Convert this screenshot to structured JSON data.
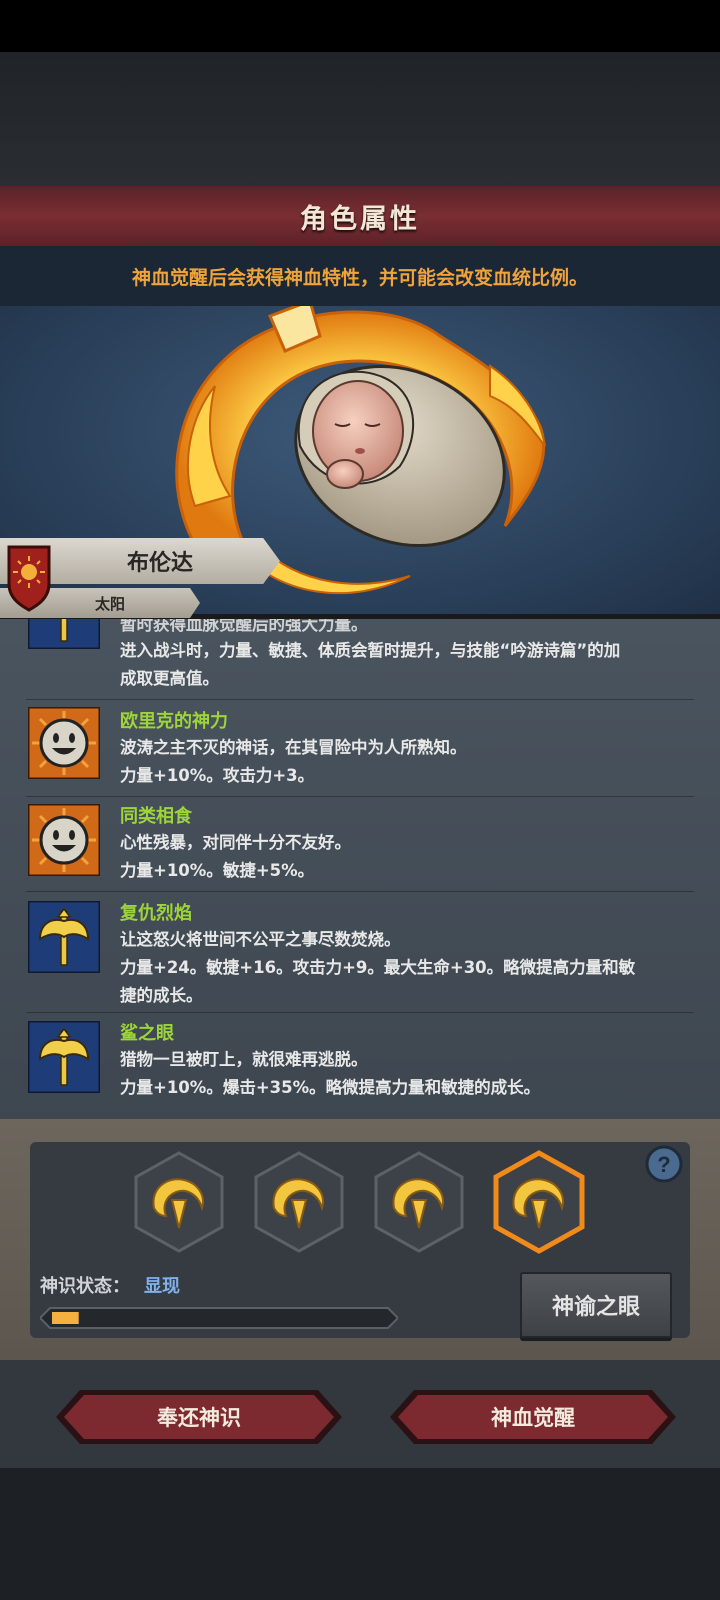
{
  "header": {
    "title": "角色属性",
    "notice": "神血觉醒后会获得神血特性，并可能会改变血统比例。"
  },
  "character": {
    "name": "布伦达",
    "deity": "太阳",
    "portrait": "swaddled-baby-with-golden-flame-ring"
  },
  "traits": {
    "partial": {
      "icon": "golden-axe-icon",
      "line_cut": "暂时获得血脉觉醒后的强大力量。",
      "line1": "进入战斗时，力量、敏捷、体质会暂时提升，与技能“吟游诗篇”的加",
      "line2": "成取更高值。"
    },
    "items": [
      {
        "icon": "smiling-face-icon",
        "name": "欧里克的神力",
        "line1": "波涛之主不灭的神话，在其冒险中为人所熟知。",
        "line2": "力量+10%。攻击力+3。"
      },
      {
        "icon": "smiling-face-icon",
        "name": "同类相食",
        "line1": "心性残暴，对同伴十分不友好。",
        "line2": "力量+10%。敏捷+5%。"
      },
      {
        "icon": "golden-axe-icon",
        "name": "复仇烈焰",
        "line1": "让这怒火将世间不公平之事尽数焚烧。",
        "line2": "力量+24。敏捷+16。攻击力+9。最大生命+30。略微提高力量和敏",
        "line3": "捷的成长。"
      },
      {
        "icon": "golden-axe-icon",
        "name": "鲨之眼",
        "line1": "猎物一旦被盯上，就很难再逃脱。",
        "line2": "力量+10%。爆击+35%。略微提高力量和敏捷的成长。"
      }
    ]
  },
  "divine": {
    "slots": [
      {
        "icon": "golden-crescent-emblem-icon",
        "selected": false
      },
      {
        "icon": "golden-crescent-emblem-icon",
        "selected": false
      },
      {
        "icon": "golden-crescent-emblem-icon",
        "selected": false
      },
      {
        "icon": "golden-crescent-emblem-icon",
        "selected": true
      }
    ],
    "status_label": "神识状态：",
    "status_value": "显现",
    "progress": 0.08,
    "oracle_button": "神谕之眼",
    "help_icon": "question-mark-icon"
  },
  "actions": {
    "return_button": "奉还神识",
    "awaken_button": "神血觉醒"
  },
  "colors": {
    "accent_orange": "#f0a33a",
    "trait_green": "#9cd43a",
    "status_blue": "#7fb2ea",
    "title_red": "#7a2e33"
  }
}
